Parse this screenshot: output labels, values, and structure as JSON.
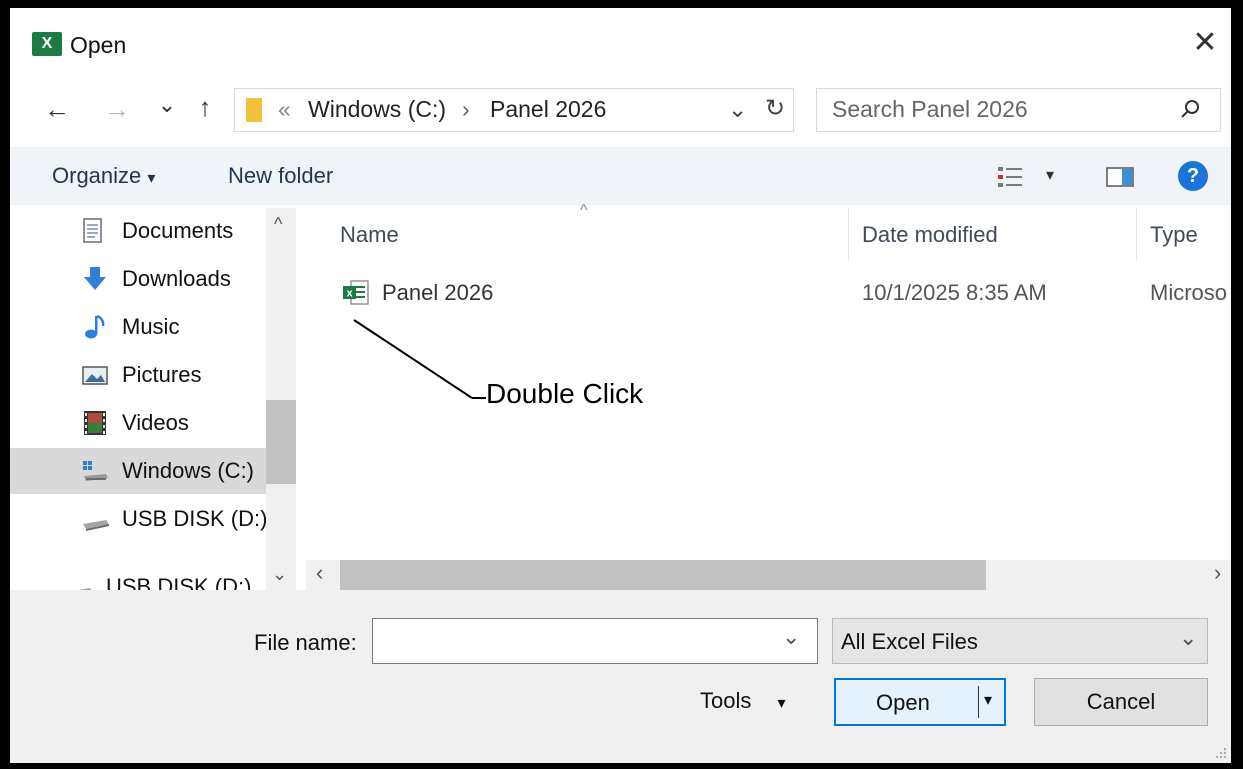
{
  "window": {
    "title": "Open",
    "close_glyph": "✕",
    "app_icon": "excel-icon"
  },
  "nav": {
    "back_glyph": "←",
    "forward_glyph": "→",
    "recent_glyph": "⌄",
    "up_glyph": "↑",
    "breadcrumb_sep": "«",
    "breadcrumb": [
      "Windows (C:)",
      "Panel 2026"
    ],
    "crumb_arrow": "›",
    "dropdown_glyph": "⌄",
    "refresh_glyph": "↻",
    "search_placeholder": "Search Panel 2026",
    "search_icon": "search-icon"
  },
  "toolbar": {
    "organize": "Organize",
    "organize_caret": "▾",
    "new_folder": "New folder",
    "view_caret": "▾",
    "help_glyph": "?"
  },
  "sidebar": {
    "items": [
      {
        "label": "Documents",
        "icon": "documents-icon"
      },
      {
        "label": "Downloads",
        "icon": "downloads-icon"
      },
      {
        "label": "Music",
        "icon": "music-icon"
      },
      {
        "label": "Pictures",
        "icon": "pictures-icon"
      },
      {
        "label": "Videos",
        "icon": "videos-icon"
      },
      {
        "label": "Windows (C:)",
        "icon": "drive-icon",
        "selected": true
      },
      {
        "label": "USB DISK (D:)",
        "icon": "usb-drive-icon"
      },
      {
        "label": "USB DISK (D:)",
        "icon": "usb-drive-icon"
      }
    ],
    "scroll_up": "^",
    "scroll_down": "⌄"
  },
  "file_list": {
    "sort_glyph": "^",
    "columns": [
      "Name",
      "Date modified",
      "Type"
    ],
    "files": [
      {
        "name": "Panel 2026",
        "date": "10/1/2025 8:35 AM",
        "type": "Microso"
      }
    ],
    "scroll_left": "‹",
    "scroll_right": "›"
  },
  "annotation": {
    "text": "Double Click"
  },
  "footer": {
    "file_name_label": "File name:",
    "file_name_value": "",
    "filter_value": "All Excel Files",
    "tools": "Tools",
    "tools_caret": "▾",
    "open": "Open",
    "open_caret": "▾",
    "cancel": "Cancel",
    "dropdown_glyph": "⌄"
  },
  "colors": {
    "excel_green": "#1d7a43",
    "help_blue": "#1a73d9",
    "toolbar_bg": "#f0f4f9",
    "focus_blue": "#0078d7"
  }
}
